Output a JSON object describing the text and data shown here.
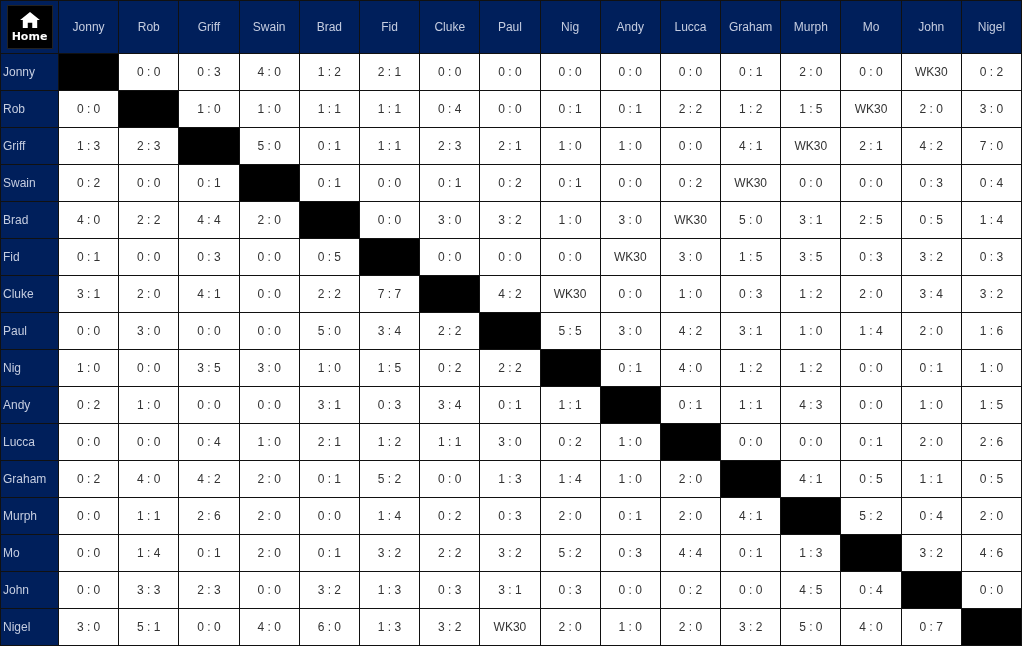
{
  "home_button": {
    "label": "Home"
  },
  "columns": [
    "Jonny",
    "Rob",
    "Griff",
    "Swain",
    "Brad",
    "Fid",
    "Cluke",
    "Paul",
    "Nig",
    "Andy",
    "Lucca",
    "Graham",
    "Murph",
    "Mo",
    "John",
    "Nigel"
  ],
  "rows": [
    {
      "name": "Jonny",
      "cells": [
        null,
        "0 : 0",
        "0 : 3",
        "4 : 0",
        "1 : 2",
        "2 : 1",
        "0 : 0",
        "0 : 0",
        "0 : 0",
        "0 : 0",
        "0 : 0",
        "0 : 1",
        "2 : 0",
        "0 : 0",
        "WK30",
        "0 : 2"
      ]
    },
    {
      "name": "Rob",
      "cells": [
        "0 : 0",
        null,
        "1 : 0",
        "1 : 0",
        "1 : 1",
        "1 : 1",
        "0 : 4",
        "0 : 0",
        "0 : 1",
        "0 : 1",
        "2 : 2",
        "1 : 2",
        "1 : 5",
        "WK30",
        "2 : 0",
        "3 : 0"
      ]
    },
    {
      "name": "Griff",
      "cells": [
        "1 : 3",
        "2 : 3",
        null,
        "5 : 0",
        "0 : 1",
        "1 : 1",
        "2 : 3",
        "2 : 1",
        "1 : 0",
        "1 : 0",
        "0 : 0",
        "4 : 1",
        "WK30",
        "2 : 1",
        "4 : 2",
        "7 : 0"
      ]
    },
    {
      "name": "Swain",
      "cells": [
        "0 : 2",
        "0 : 0",
        "0 : 1",
        null,
        "0 : 1",
        "0 : 0",
        "0 : 1",
        "0 : 2",
        "0 : 1",
        "0 : 0",
        "0 : 2",
        "WK30",
        "0 : 0",
        "0 : 0",
        "0 : 3",
        "0 : 4"
      ]
    },
    {
      "name": "Brad",
      "cells": [
        "4 : 0",
        "2 : 2",
        "4 : 4",
        "2 : 0",
        null,
        "0 : 0",
        "3 : 0",
        "3 : 2",
        "1 : 0",
        "3 : 0",
        "WK30",
        "5 : 0",
        "3 : 1",
        "2 : 5",
        "0 : 5",
        "1 : 4"
      ]
    },
    {
      "name": "Fid",
      "cells": [
        "0 : 1",
        "0 : 0",
        "0 : 3",
        "0 : 0",
        "0 : 5",
        null,
        "0 : 0",
        "0 : 0",
        "0 : 0",
        "WK30",
        "3 : 0",
        "1 : 5",
        "3 : 5",
        "0 : 3",
        "3 : 2",
        "0 : 3"
      ]
    },
    {
      "name": "Cluke",
      "cells": [
        "3 : 1",
        "2 : 0",
        "4 : 1",
        "0 : 0",
        "2 : 2",
        "7 : 7",
        null,
        "4 : 2",
        "WK30",
        "0 : 0",
        "1 : 0",
        "0 : 3",
        "1 : 2",
        "2 : 0",
        "3 : 4",
        "3 : 2"
      ]
    },
    {
      "name": "Paul",
      "cells": [
        "0 : 0",
        "3 : 0",
        "0 : 0",
        "0 : 0",
        "5 : 0",
        "3 : 4",
        "2 : 2",
        null,
        "5 : 5",
        "3 : 0",
        "4 : 2",
        "3 : 1",
        "1 : 0",
        "1 : 4",
        "2 : 0",
        "1 : 6"
      ]
    },
    {
      "name": "Nig",
      "cells": [
        "1 : 0",
        "0 : 0",
        "3 : 5",
        "3 : 0",
        "1 : 0",
        "1 : 5",
        "0 : 2",
        "2 : 2",
        null,
        "0 : 1",
        "4 : 0",
        "1 : 2",
        "1 : 2",
        "0 : 0",
        "0 : 1",
        "1 : 0"
      ]
    },
    {
      "name": "Andy",
      "cells": [
        "0 : 2",
        "1 : 0",
        "0 : 0",
        "0 : 0",
        "3 : 1",
        "0 : 3",
        "3 : 4",
        "0 : 1",
        "1 : 1",
        null,
        "0 : 1",
        "1 : 1",
        "4 : 3",
        "0 : 0",
        "1 : 0",
        "1 : 5"
      ]
    },
    {
      "name": "Lucca",
      "cells": [
        "0 : 0",
        "0 : 0",
        "0 : 4",
        "1 : 0",
        "2 : 1",
        "1 : 2",
        "1 : 1",
        "3 : 0",
        "0 : 2",
        "1 : 0",
        null,
        "0 : 0",
        "0 : 0",
        "0 : 1",
        "2 : 0",
        "2 : 6"
      ]
    },
    {
      "name": "Graham",
      "cells": [
        "0 : 2",
        "4 : 0",
        "4 : 2",
        "2 : 0",
        "0 : 1",
        "5 : 2",
        "0 : 0",
        "1 : 3",
        "1 : 4",
        "1 : 0",
        "2 : 0",
        null,
        "4 : 1",
        "0 : 5",
        "1 : 1",
        "0 : 5"
      ]
    },
    {
      "name": "Murph",
      "cells": [
        "0 : 0",
        "1 : 1",
        "2 : 6",
        "2 : 0",
        "0 : 0",
        "1 : 4",
        "0 : 2",
        "0 : 3",
        "2 : 0",
        "0 : 1",
        "2 : 0",
        "4 : 1",
        null,
        "5 : 2",
        "0 : 4",
        "2 : 0"
      ]
    },
    {
      "name": "Mo",
      "cells": [
        "0 : 0",
        "1 : 4",
        "0 : 1",
        "2 : 0",
        "0 : 1",
        "3 : 2",
        "2 : 2",
        "3 : 2",
        "5 : 2",
        "0 : 3",
        "4 : 4",
        "0 : 1",
        "1 : 3",
        null,
        "3 : 2",
        "4 : 6"
      ]
    },
    {
      "name": "John",
      "cells": [
        "0 : 0",
        "3 : 3",
        "2 : 3",
        "0 : 0",
        "3 : 2",
        "1 : 3",
        "0 : 3",
        "3 : 1",
        "0 : 3",
        "0 : 0",
        "0 : 2",
        "0 : 0",
        "4 : 5",
        "0 : 4",
        null,
        "0 : 0"
      ]
    },
    {
      "name": "Nigel",
      "cells": [
        "3 : 0",
        "5 : 1",
        "0 : 0",
        "4 : 0",
        "6 : 0",
        "1 : 3",
        "3 : 2",
        "WK30",
        "2 : 0",
        "1 : 0",
        "2 : 0",
        "3 : 2",
        "5 : 0",
        "4 : 0",
        "0 : 7",
        null
      ]
    }
  ]
}
